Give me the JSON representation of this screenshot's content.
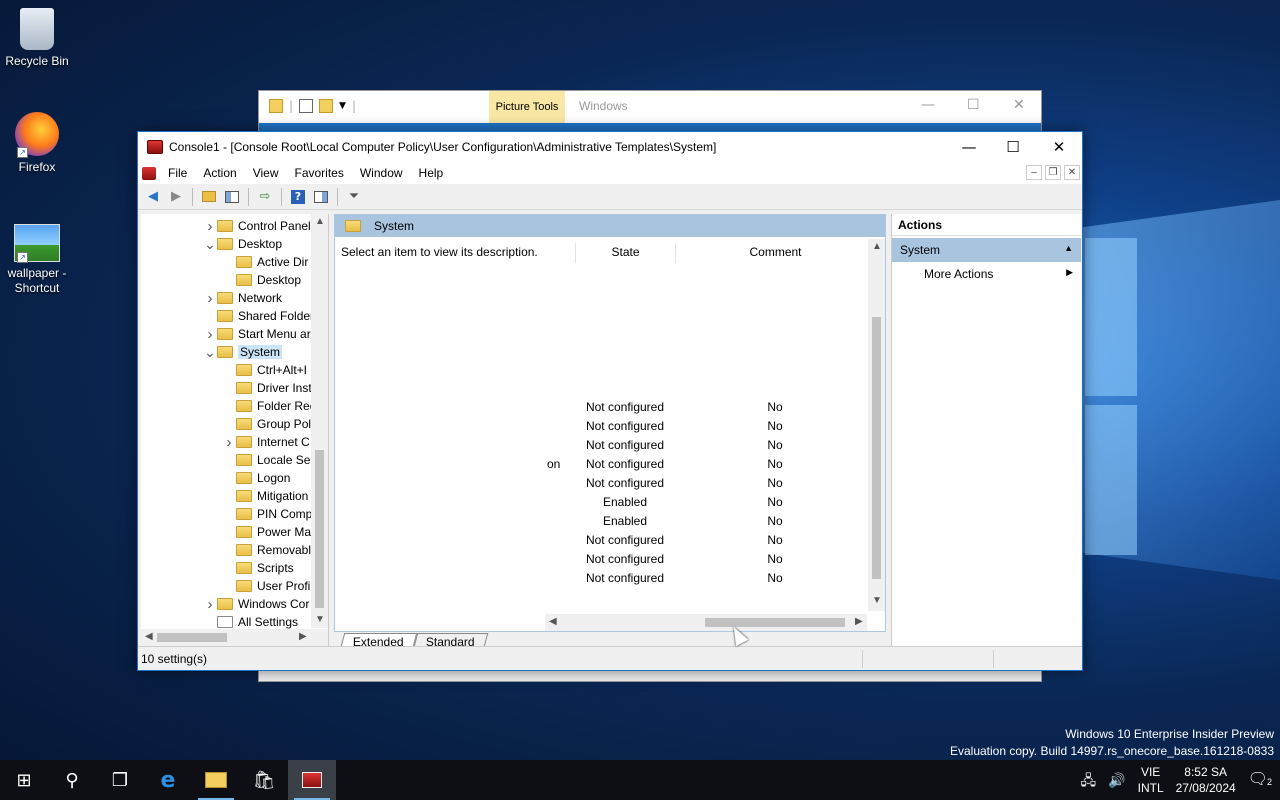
{
  "desktop": {
    "icons": [
      {
        "label": "Recycle Bin"
      },
      {
        "label": "Firefox"
      },
      {
        "label": "wallpaper - Shortcut"
      }
    ]
  },
  "background_window": {
    "picture_tools": "Picture Tools",
    "title": "Windows",
    "status_items": "",
    "status_selected": ""
  },
  "window": {
    "title": "Console1 - [Console Root\\Local Computer Policy\\User Configuration\\Administrative Templates\\System]",
    "menu": [
      "File",
      "Action",
      "View",
      "Favorites",
      "Window",
      "Help"
    ]
  },
  "tree": {
    "items": [
      {
        "label": "Control Panel",
        "level": 1,
        "twist": "collapsed"
      },
      {
        "label": "Desktop",
        "level": 1,
        "twist": "expanded"
      },
      {
        "label": "Active Dir",
        "level": 2,
        "twist": "none"
      },
      {
        "label": "Desktop",
        "level": 2,
        "twist": "none"
      },
      {
        "label": "Network",
        "level": 1,
        "twist": "collapsed"
      },
      {
        "label": "Shared Folder",
        "level": 1,
        "twist": "none"
      },
      {
        "label": "Start Menu ar",
        "level": 1,
        "twist": "collapsed"
      },
      {
        "label": "System",
        "level": 1,
        "twist": "expanded",
        "selected": true
      },
      {
        "label": "Ctrl+Alt+I",
        "level": 2,
        "twist": "none"
      },
      {
        "label": "Driver Inst",
        "level": 2,
        "twist": "none"
      },
      {
        "label": "Folder Rec",
        "level": 2,
        "twist": "none"
      },
      {
        "label": "Group Pol",
        "level": 2,
        "twist": "none"
      },
      {
        "label": "Internet C",
        "level": 2,
        "twist": "collapsed"
      },
      {
        "label": "Locale Ser",
        "level": 2,
        "twist": "none"
      },
      {
        "label": "Logon",
        "level": 2,
        "twist": "none"
      },
      {
        "label": "Mitigation",
        "level": 2,
        "twist": "none"
      },
      {
        "label": "PIN Comp",
        "level": 2,
        "twist": "none"
      },
      {
        "label": "Power Ma",
        "level": 2,
        "twist": "none"
      },
      {
        "label": "Removabl",
        "level": 2,
        "twist": "none"
      },
      {
        "label": "Scripts",
        "level": 2,
        "twist": "none"
      },
      {
        "label": "User Profi",
        "level": 2,
        "twist": "none"
      },
      {
        "label": "Windows Cor",
        "level": 1,
        "twist": "collapsed"
      },
      {
        "label": "All Settings",
        "level": 1,
        "twist": "none",
        "doc": true
      }
    ]
  },
  "center": {
    "header": "System",
    "description": "Select an item to view its description.",
    "columns": {
      "state": "State",
      "comment": "Comment"
    },
    "rows": [
      {
        "setting": "",
        "state": "Not configured",
        "comment": "No"
      },
      {
        "setting": "",
        "state": "Not configured",
        "comment": "No"
      },
      {
        "setting": "",
        "state": "Not configured",
        "comment": "No"
      },
      {
        "setting": "on",
        "state": "Not configured",
        "comment": "No"
      },
      {
        "setting": "",
        "state": "Not configured",
        "comment": "No"
      },
      {
        "setting": "",
        "state": "Enabled",
        "comment": "No"
      },
      {
        "setting": "",
        "state": "Enabled",
        "comment": "No"
      },
      {
        "setting": "",
        "state": "Not configured",
        "comment": "No"
      },
      {
        "setting": "",
        "state": "Not configured",
        "comment": "No"
      },
      {
        "setting": "",
        "state": "Not configured",
        "comment": "No"
      }
    ],
    "tabs": [
      "Extended",
      "Standard"
    ]
  },
  "actions": {
    "header": "Actions",
    "section": "System",
    "items": [
      "More Actions"
    ]
  },
  "status": {
    "text": "10 setting(s)"
  },
  "watermark": {
    "line1": "Windows 10 Enterprise Insider Preview",
    "line2": "Evaluation copy. Build 14997.rs_onecore_base.161218-0833"
  },
  "tray": {
    "lang": "VIE",
    "layout": "INTL",
    "time": "8:52 SA",
    "date": "27/08/2024",
    "notifications": "2"
  },
  "colors": {
    "accent": "#1e73c8",
    "selection": "#a9c4df"
  }
}
